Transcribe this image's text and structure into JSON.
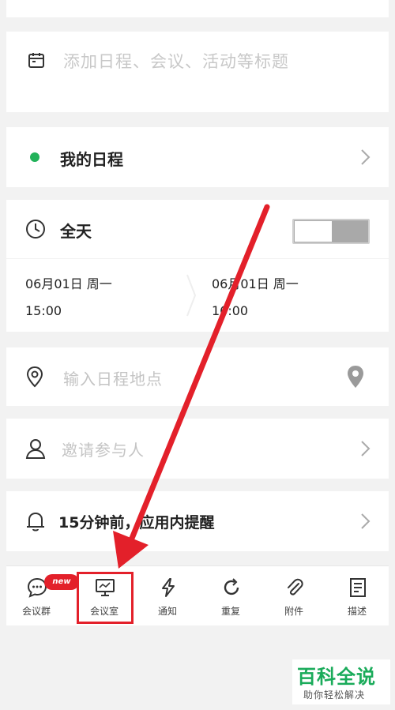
{
  "title_input": {
    "placeholder": "添加日程、会议、活动等标题"
  },
  "schedule": {
    "label": "我的日程",
    "dot_color": "#22b25a"
  },
  "all_day": {
    "label": "全天",
    "enabled": false
  },
  "time": {
    "start_date": "06月01日 周一",
    "start_time": "15:00",
    "end_date": "06月01日 周一",
    "end_time": "16:00"
  },
  "location": {
    "placeholder": "输入日程地点"
  },
  "invite": {
    "placeholder": "邀请参与人"
  },
  "reminder": {
    "label": "15分钟前，应用内提醒"
  },
  "toolbar": {
    "items": [
      {
        "label": "会议群",
        "icon": "chat-bubble-icon",
        "badge": "new"
      },
      {
        "label": "会议室",
        "icon": "monitor-icon"
      },
      {
        "label": "通知",
        "icon": "lightning-icon"
      },
      {
        "label": "重复",
        "icon": "repeat-icon"
      },
      {
        "label": "附件",
        "icon": "paperclip-icon"
      },
      {
        "label": "描述",
        "icon": "document-icon"
      }
    ]
  },
  "watermark": {
    "main": "百科全说",
    "sub": "助你轻松解决"
  },
  "colors": {
    "accent_red": "#e3202a",
    "green": "#22b25a"
  }
}
